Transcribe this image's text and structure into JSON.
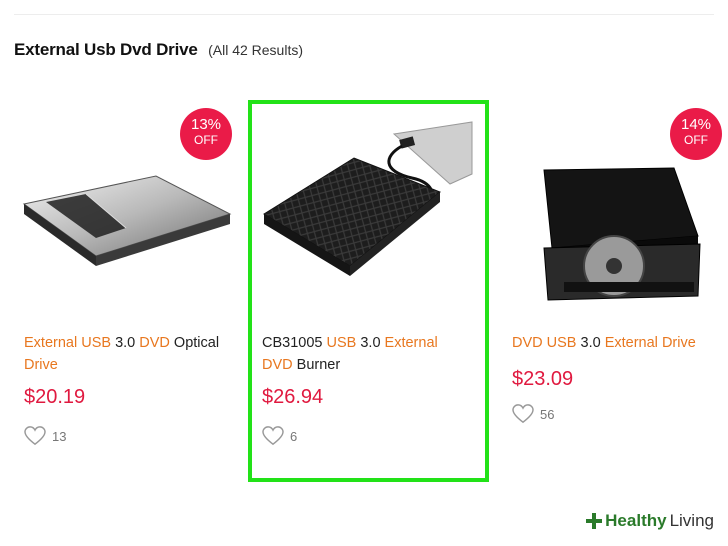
{
  "header": {
    "title": "External Usb Dvd Drive",
    "count": "(All 42 Results)"
  },
  "products": [
    {
      "discount": "13%",
      "discount_suffix": "OFF",
      "title_parts": [
        {
          "text": "External",
          "kw": true
        },
        {
          "text": " ",
          "kw": false
        },
        {
          "text": "USB",
          "kw": true
        },
        {
          "text": " 3.0 ",
          "kw": false
        },
        {
          "text": "DVD",
          "kw": true
        },
        {
          "text": " Optical ",
          "kw": false
        },
        {
          "text": "Drive",
          "kw": true
        }
      ],
      "price": "$20.19",
      "likes": "13"
    },
    {
      "title_parts": [
        {
          "text": "CB31005 ",
          "kw": false
        },
        {
          "text": "USB",
          "kw": true
        },
        {
          "text": " 3.0 ",
          "kw": false
        },
        {
          "text": "External",
          "kw": true
        },
        {
          "text": " ",
          "kw": false
        },
        {
          "text": "DVD",
          "kw": true
        },
        {
          "text": " Burner",
          "kw": false
        }
      ],
      "price": "$26.94",
      "likes": "6"
    },
    {
      "discount": "14%",
      "discount_suffix": "OFF",
      "title_parts": [
        {
          "text": "DVD",
          "kw": true
        },
        {
          "text": " ",
          "kw": false
        },
        {
          "text": "USB",
          "kw": true
        },
        {
          "text": " 3.0 ",
          "kw": false
        },
        {
          "text": "External",
          "kw": true
        },
        {
          "text": " ",
          "kw": false
        },
        {
          "text": "Drive",
          "kw": true
        }
      ],
      "price": "$23.09",
      "likes": "56"
    }
  ],
  "colors": {
    "accent_price": "#e0193f",
    "keyword": "#e8771f",
    "badge": "#ea1b48",
    "highlight": "#22e218"
  },
  "watermark": {
    "brand": "Healthy",
    "suffix": "Living"
  }
}
